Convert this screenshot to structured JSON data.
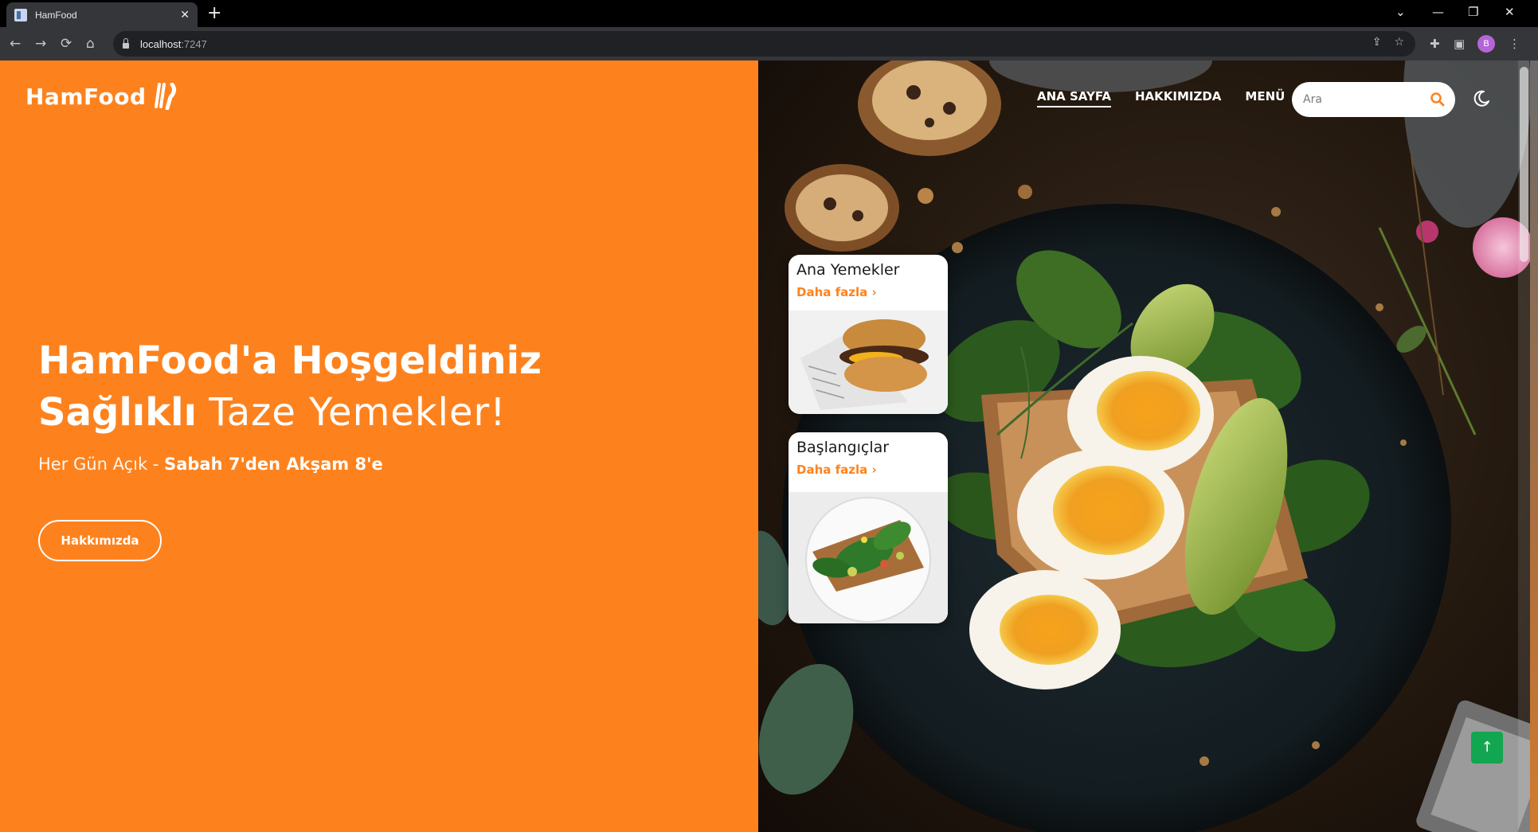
{
  "browser": {
    "tab_title": "HamFood",
    "url_host": "localhost",
    "url_port": ":7247",
    "profile_initial": "B"
  },
  "site": {
    "logo_text": "HamFood",
    "nav": [
      {
        "label": "ANA SAYFA",
        "active": true
      },
      {
        "label": "HAKKIMIZDA",
        "active": false
      },
      {
        "label": "MENÜ",
        "active": false
      }
    ],
    "search_placeholder": "Ara",
    "hero": {
      "title": "HamFood'a Hoşgeldiniz",
      "subtitle_bold": "Sağlıklı",
      "subtitle_light": "Taze Yemekler!",
      "hours_light": "Her Gün Açık -",
      "hours_bold": "Sabah 7'den Akşam 8'e",
      "button_label": "Hakkımızda"
    },
    "cards": [
      {
        "title": "Ana Yemekler",
        "more": "Daha fazla",
        "arrow": "›"
      },
      {
        "title": "Başlangıçlar",
        "more": "Daha fazla",
        "arrow": "›"
      }
    ],
    "scroll_top_symbol": "↑"
  },
  "colors": {
    "brand_orange": "#fd821e",
    "scroll_top_green": "#12a650"
  },
  "icons": [
    "utensils-icon",
    "search-icon",
    "moon-icon",
    "arrow-up-icon",
    "lock-icon",
    "star-icon",
    "share-icon",
    "extensions-icon",
    "sidepanel-icon",
    "kebab-menu-icon"
  ]
}
